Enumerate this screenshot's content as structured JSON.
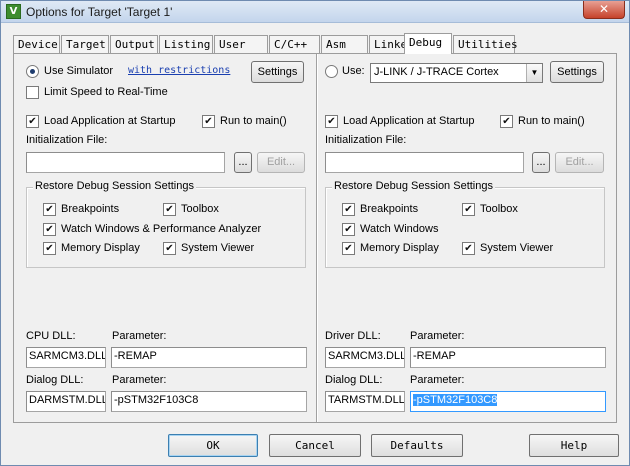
{
  "window": {
    "title": "Options for Target 'Target 1'",
    "close_glyph": "✕",
    "app_icon_glyph": "V"
  },
  "tabs": [
    {
      "label": "Device"
    },
    {
      "label": "Target"
    },
    {
      "label": "Output"
    },
    {
      "label": "Listing"
    },
    {
      "label": "User"
    },
    {
      "label": "C/C++"
    },
    {
      "label": "Asm"
    },
    {
      "label": "Linker"
    },
    {
      "label": "Debug"
    },
    {
      "label": "Utilities"
    }
  ],
  "left": {
    "use_simulator_label": "Use Simulator",
    "restrictions_link": "with restrictions",
    "settings_button": "Settings",
    "limit_speed_label": "Limit Speed to Real-Time",
    "load_app_label": "Load Application at Startup",
    "run_to_main_label": "Run to main()",
    "init_file_label": "Initialization File:",
    "init_file_value": "",
    "browse_button": "...",
    "edit_button": "Edit...",
    "restore_group_label": "Restore Debug Session Settings",
    "breakpoints_label": "Breakpoints",
    "toolbox_label": "Toolbox",
    "watch_label": "Watch Windows & Performance Analyzer",
    "memory_label": "Memory Display",
    "sysviewer_label": "System Viewer",
    "dll_label": "CPU DLL:",
    "param_label": "Parameter:",
    "dll_value": "SARMCM3.DLL",
    "param_value": "-REMAP",
    "dialog_dll_label": "Dialog DLL:",
    "dialog_param_label": "Parameter:",
    "dialog_dll_value": "DARMSTM.DLL",
    "dialog_param_value": "-pSTM32F103C8"
  },
  "right": {
    "use_label": "Use:",
    "debugger_select": "J-LINK / J-TRACE Cortex",
    "settings_button": "Settings",
    "load_app_label": "Load Application at Startup",
    "run_to_main_label": "Run to main()",
    "init_file_label": "Initialization File:",
    "init_file_value": "",
    "browse_button": "...",
    "edit_button": "Edit...",
    "restore_group_label": "Restore Debug Session Settings",
    "breakpoints_label": "Breakpoints",
    "toolbox_label": "Toolbox",
    "watch_label": "Watch Windows",
    "memory_label": "Memory Display",
    "sysviewer_label": "System Viewer",
    "dll_label": "Driver DLL:",
    "param_label": "Parameter:",
    "dll_value": "SARMCM3.DLL",
    "param_value": "-REMAP",
    "dialog_dll_label": "Dialog DLL:",
    "dialog_param_label": "Parameter:",
    "dialog_dll_value": "TARMSTM.DLL",
    "dialog_param_value": "-pSTM32F103C8"
  },
  "check_glyph": "✔",
  "dropdown_glyph": "▼",
  "buttons": {
    "ok": "OK",
    "cancel": "Cancel",
    "defaults": "Defaults",
    "help": "Help"
  }
}
